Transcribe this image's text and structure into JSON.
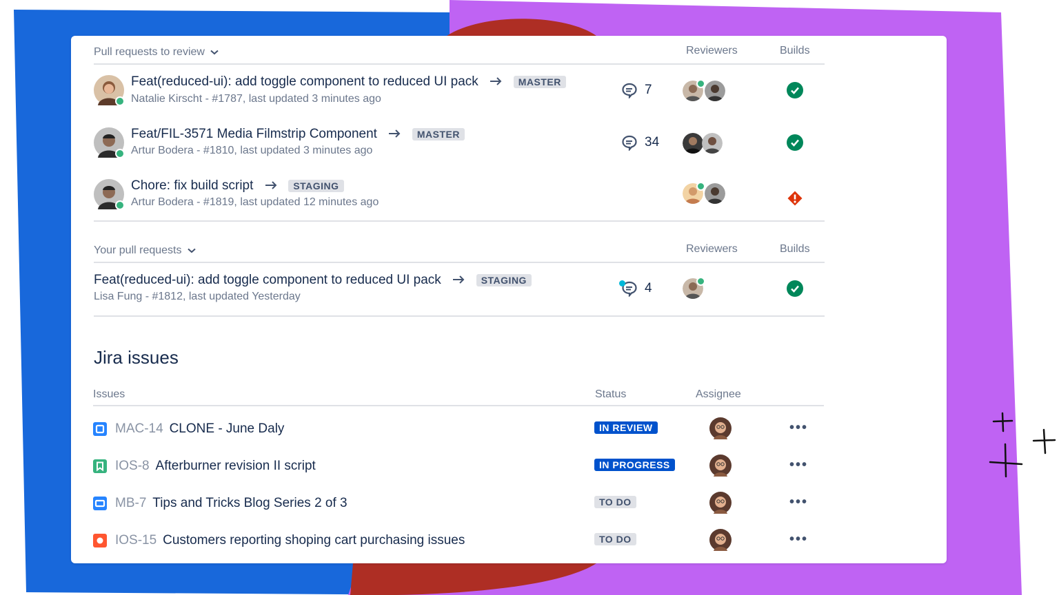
{
  "colors": {
    "blue_bg": "#1868DB",
    "red_bg": "#AE2E24",
    "purple_bg": "#BF63F3",
    "success": "#00875A",
    "error": "#DE350B",
    "lozenge_blue": "#0052CC"
  },
  "review_section": {
    "heading": "Pull requests to review",
    "col_reviewers": "Reviewers",
    "col_builds": "Builds",
    "rows": [
      {
        "title": "Feat(reduced-ui): add toggle component to reduced UI pack",
        "branch": "MASTER",
        "meta": "Natalie Kirscht - #1787, last updated  3 minutes ago",
        "comments": "7",
        "build": "success"
      },
      {
        "title": "Feat/FIL-3571 Media Filmstrip Component",
        "branch": "MASTER",
        "meta": "Artur Bodera - #1810, last updated 3 minutes ago",
        "comments": "34",
        "build": "success"
      },
      {
        "title": "Chore: fix build script",
        "branch": "STAGING",
        "meta": "Artur Bodera - #1819, last updated  12 minutes ago",
        "comments": "",
        "build": "failed"
      }
    ]
  },
  "your_section": {
    "heading": "Your pull requests",
    "col_reviewers": "Reviewers",
    "col_builds": "Builds",
    "rows": [
      {
        "title": "Feat(reduced-ui): add toggle component to reduced UI pack",
        "branch": "STAGING",
        "meta": "Lisa Fung - #1812, last updated Yesterday",
        "comments": "4",
        "build": "success"
      }
    ]
  },
  "jira": {
    "title": "Jira issues",
    "col_issues": "Issues",
    "col_status": "Status",
    "col_assignee": "Assignee",
    "rows": [
      {
        "type": "task-icon",
        "key": "MAC-14",
        "summary": "CLONE - June Daly",
        "status": "IN REVIEW"
      },
      {
        "type": "story-icon",
        "key": "IOS-8",
        "summary": "Afterburner revision II script",
        "status": "IN PROGRESS"
      },
      {
        "type": "epic-icon",
        "key": "MB-7",
        "summary": "Tips and Tricks Blog Series 2 of 3",
        "status": "TO DO"
      },
      {
        "type": "bug-icon",
        "key": "IOS-15",
        "summary": "Customers reporting shoping cart purchasing issues",
        "status": "TO DO"
      }
    ],
    "more_label": "•••"
  }
}
